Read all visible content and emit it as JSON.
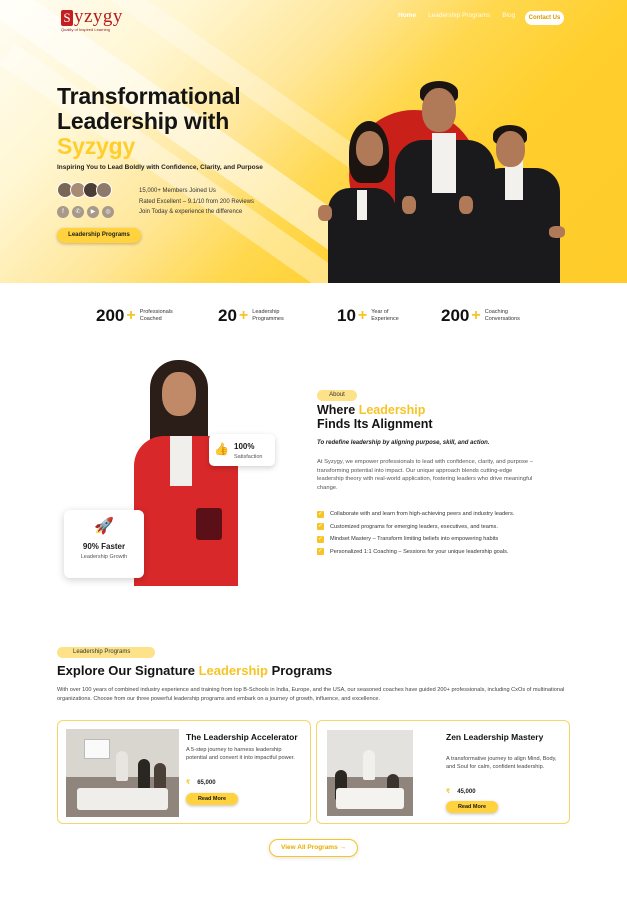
{
  "brand": {
    "logo_letter": "S",
    "logo_rest": "yzygy",
    "tagline": "Quality of Inspired Learning"
  },
  "nav": {
    "items": [
      "Home",
      "Leadership Programs",
      "Blog"
    ],
    "contact_label": "Contact Us"
  },
  "hero": {
    "title_line1": "Transformational",
    "title_line2": "Leadership with",
    "title_highlight": "Syzygy",
    "subtitle": "Inspiring You to Lead Boldly with Confidence, Clarity, and Purpose",
    "members": "15,000+ Members Joined Us",
    "rating": "Rated Excellent – 9.1/10 from 200 Reviews",
    "join": "Join Today & experience the difference",
    "cta": "Leadership Programs",
    "socials": [
      "facebook-icon",
      "whatsapp-icon",
      "youtube-icon",
      "instagram-icon"
    ]
  },
  "stats": [
    {
      "number": "200",
      "label_l1": "Professionals",
      "label_l2": "Coached"
    },
    {
      "number": "20",
      "label_l1": "Leadership",
      "label_l2": "Programmes"
    },
    {
      "number": "10",
      "label_l1": "Year of",
      "label_l2": "Experience"
    },
    {
      "number": "200",
      "label_l1": "Coaching",
      "label_l2": "Conversations"
    }
  ],
  "about": {
    "pill": "About",
    "title_a": "Where ",
    "title_hl": "Leadership",
    "title_b": "Finds Its Alignment",
    "lead": "To redefine leadership by aligning purpose, skill, and action.",
    "body": "At Syzygy, we empower professionals to lead with confidence, clarity, and purpose – transforming potential into impact. Our unique approach blends cutting-edge leadership theory with real-world application, fostering leaders who drive meaningful change.",
    "checks": [
      "Collaborate with and learn from high-achieving peers and industry leaders.",
      "Customized programs for emerging leaders, executives, and teams.",
      "Mindset Mastery – Transform limiting beliefs into empowering habits",
      "Personalized 1:1 Coaching – Sessions for your unique leadership goals."
    ],
    "satisfaction_value": "100%",
    "satisfaction_label": "Satisfaction",
    "growth_value": "90% Faster",
    "growth_label": "Leadership Growth"
  },
  "programs": {
    "pill": "Leadership Programs",
    "title_a": "Explore Our Signature ",
    "title_hl": "Leadership",
    "title_b": " Programs",
    "desc": "With over 100 years of combined industry experience and training from top B-Schools in India, Europe, and the USA, our seasoned coaches have guided 200+ professionals, including CxOs of multinational organizations. Choose from our three powerful leadership programs and embark on a journey of growth, influence, and excellence.",
    "cards": [
      {
        "title": "The Leadership Accelerator",
        "desc": "A 5-step journey to harness leadership potential and convert it into impactful power.",
        "currency": "₹",
        "price": "65,000",
        "button": "Read More"
      },
      {
        "title": "Zen Leadership Mastery",
        "desc": "A transformative journey to align Mind, Body, and Soul for calm, confident leadership.",
        "currency": "₹",
        "price": "45,000",
        "button": "Read More"
      }
    ],
    "view_all": "View All Programs →"
  },
  "colors": {
    "accent": "#f6c426",
    "brand_red": "#c41e1e"
  }
}
